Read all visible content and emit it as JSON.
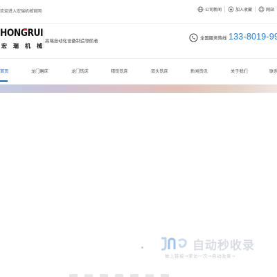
{
  "topbar": {
    "welcome": "欢迎进入宏瑞机械官网",
    "links": [
      {
        "label": "公司新闻",
        "icon": "globe-icon"
      },
      {
        "label": "加入收藏",
        "icon": "star-icon"
      },
      {
        "label": "网站",
        "icon": "sitemap-icon"
      }
    ]
  },
  "header": {
    "logo_text": "HONGRUI",
    "logo_cn": "宏瑞机械",
    "slogan": "高端自动化设备制造领航者",
    "hotline_label": "全国服务热线",
    "phone": "133-8019-99"
  },
  "nav": {
    "items": [
      "首页",
      "龙门磨床",
      "龙门铣床",
      "精铣铣床",
      "双头铣床",
      "新闻资讯",
      "关于我们",
      "联系"
    ],
    "active_index": 0
  },
  "watermark": {
    "brand": "自动秒收录",
    "sub": "做上链接→来访一次→自动收录→"
  },
  "colors": {
    "accent": "#1a62c4",
    "phone": "#1f7bd6",
    "logo_red": "#d7262f"
  }
}
